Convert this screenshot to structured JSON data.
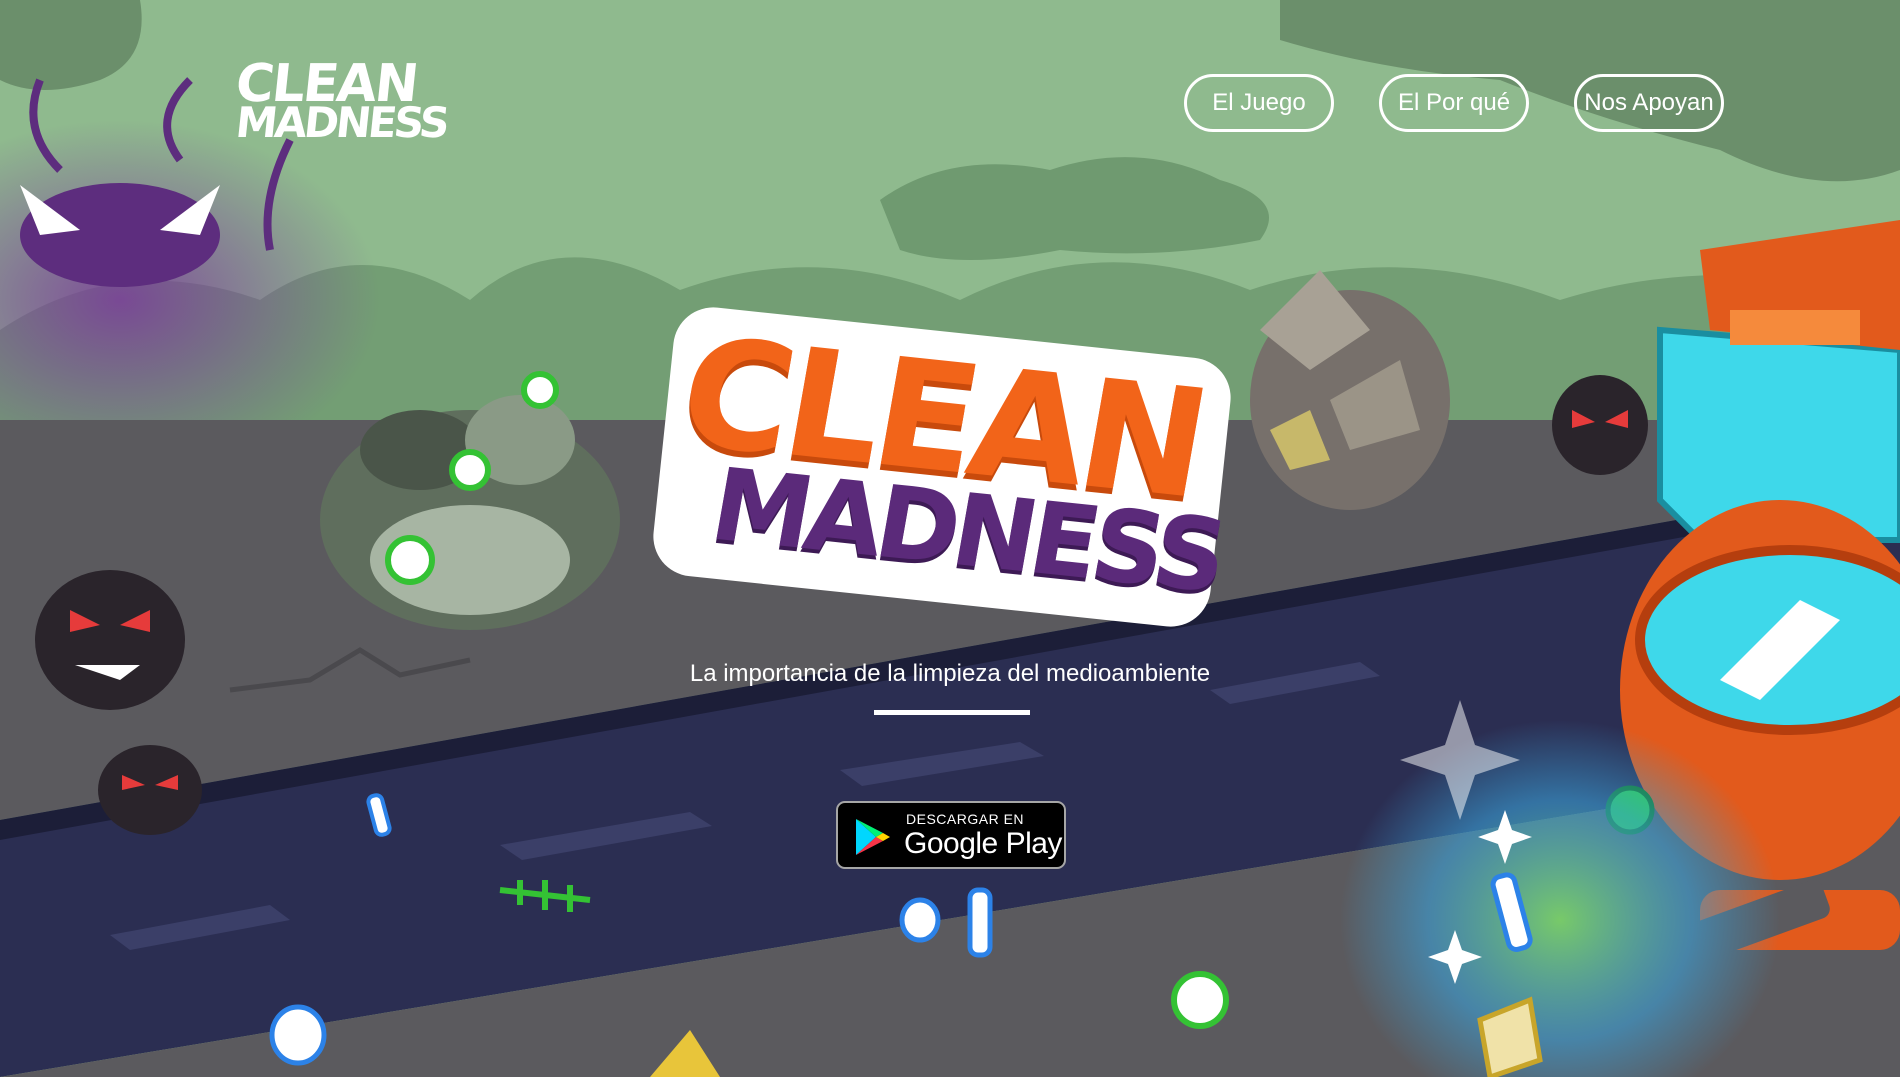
{
  "nav": {
    "items": [
      {
        "label": "El Juego"
      },
      {
        "label": "El Por qué"
      },
      {
        "label": "Nos Apoyan"
      }
    ]
  },
  "brand": {
    "small_logo_line1": "CLEAN",
    "small_logo_line2": "MADNESS",
    "big_logo_line1": "CLEAN",
    "big_logo_line2": "MADNESS"
  },
  "hero": {
    "tagline": "La importancia de la limpieza del medioambiente"
  },
  "download": {
    "line1": "DESCARGAR EN",
    "line2": "Google Play"
  },
  "colors": {
    "sky": "#8fba8e",
    "road": "#2b2e52",
    "sidewalk": "#5b5a5e",
    "brand_orange": "#f26419",
    "brand_purple": "#5b2a7a",
    "accent_cyan": "#3ed8ea"
  }
}
